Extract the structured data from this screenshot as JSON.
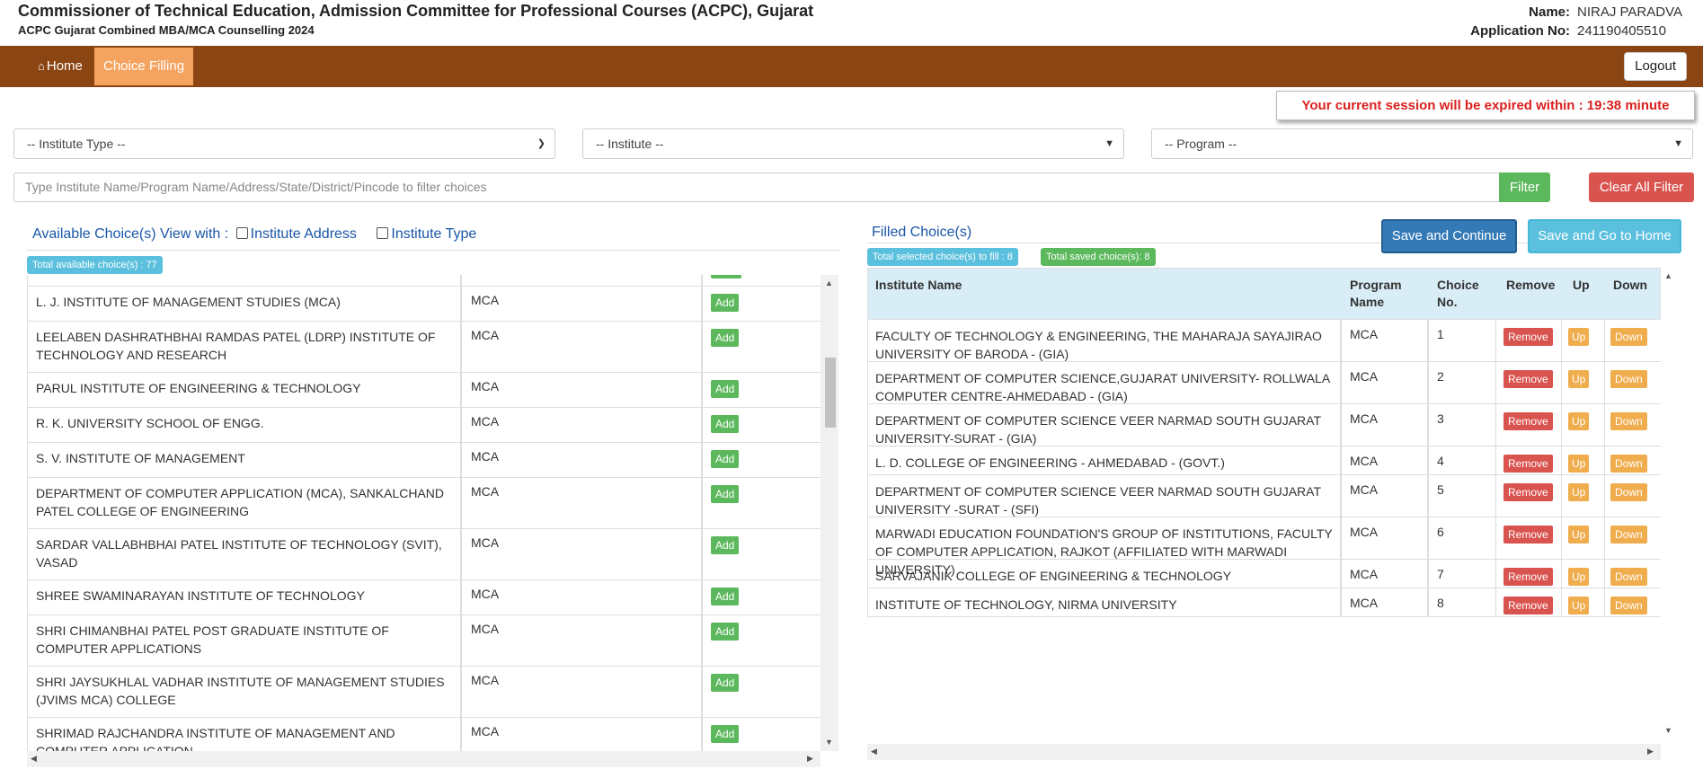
{
  "header": {
    "title": "Commissioner of Technical Education, Admission Committee for Professional Courses (ACPC), Gujarat",
    "subtitle": "ACPC Gujarat Combined MBA/MCA Counselling 2024",
    "name_label": "Name:",
    "name_value": "NIRAJ PARADVA",
    "app_label": "Application No:",
    "app_value": "241190405510"
  },
  "nav": {
    "home": "Home",
    "choice_filling": "Choice Filling",
    "logout": "Logout"
  },
  "session": {
    "text": "Your current session will be expired within : 19:38 minute"
  },
  "filters": {
    "institute_type": "-- Institute Type --",
    "institute": "-- Institute --",
    "program": "-- Program --",
    "search_placeholder": "Type Institute Name/Program Name/Address/State/District/Pincode to filter choices",
    "filter_btn": "Filter",
    "clear_btn": "Clear All Filter"
  },
  "available": {
    "heading": "Available Choice(s) View with :",
    "opt_address": "Institute Address",
    "opt_type": "Institute Type",
    "total_badge": "Total available choice(s) : 77",
    "add_label": "Add",
    "rows": [
      {
        "name": "L. J. INSTITUTE OF MANAGEMENT STUDIES (MCA)",
        "program": "MCA"
      },
      {
        "name": "LEELABEN DASHRATHBHAI RAMDAS PATEL (LDRP) INSTITUTE OF TECHNOLOGY AND RESEARCH",
        "program": "MCA"
      },
      {
        "name": "PARUL INSTITUTE OF ENGINEERING & TECHNOLOGY",
        "program": "MCA"
      },
      {
        "name": "R. K. UNIVERSITY SCHOOL OF ENGG.",
        "program": "MCA"
      },
      {
        "name": "S. V. INSTITUTE OF MANAGEMENT",
        "program": "MCA"
      },
      {
        "name": "DEPARTMENT OF COMPUTER APPLICATION (MCA), SANKALCHAND PATEL COLLEGE OF ENGINEERING",
        "program": "MCA"
      },
      {
        "name": "SARDAR VALLABHBHAI PATEL INSTITUTE OF TECHNOLOGY (SVIT), VASAD",
        "program": "MCA"
      },
      {
        "name": "SHREE SWAMINARAYAN INSTITUTE OF TECHNOLOGY",
        "program": "MCA"
      },
      {
        "name": "SHRI CHIMANBHAI PATEL POST GRADUATE INSTITUTE OF COMPUTER APPLICATIONS",
        "program": "MCA"
      },
      {
        "name": "SHRI JAYSUKHLAL VADHAR INSTITUTE OF MANAGEMENT STUDIES (JVIMS MCA) COLLEGE",
        "program": "MCA"
      },
      {
        "name": "SHRIMAD RAJCHANDRA INSTITUTE OF MANAGEMENT AND COMPUTER APPLICATION",
        "program": "MCA"
      }
    ]
  },
  "filled": {
    "heading": "Filled Choice(s)",
    "save_continue": "Save and Continue",
    "save_home": "Save and Go to Home",
    "selected_badge": "Total selected choice(s) to fill : 8",
    "saved_badge": "Total saved choice(s): 8",
    "columns": {
      "institute": "Institute Name",
      "program": "Program Name",
      "choice": "Choice No.",
      "remove": "Remove",
      "up": "Up",
      "down": "Down"
    },
    "btn_remove": "Remove",
    "btn_up": "Up",
    "btn_down": "Down",
    "rows": [
      {
        "name": "FACULTY OF TECHNOLOGY & ENGINEERING, THE MAHARAJA SAYAJIRAO UNIVERSITY OF BARODA - (GIA)",
        "program": "MCA",
        "choice": "1"
      },
      {
        "name": "DEPARTMENT OF COMPUTER SCIENCE,GUJARAT UNIVERSITY- ROLLWALA COMPUTER CENTRE-AHMEDABAD - (GIA)",
        "program": "MCA",
        "choice": "2"
      },
      {
        "name": "DEPARTMENT OF COMPUTER SCIENCE VEER NARMAD SOUTH GUJARAT UNIVERSITY-SURAT - (GIA)",
        "program": "MCA",
        "choice": "3"
      },
      {
        "name": "L. D. COLLEGE OF ENGINEERING - AHMEDABAD - (GOVT.)",
        "program": "MCA",
        "choice": "4"
      },
      {
        "name": "DEPARTMENT OF COMPUTER SCIENCE VEER NARMAD SOUTH GUJARAT UNIVERSITY -SURAT - (SFI)",
        "program": "MCA",
        "choice": "5"
      },
      {
        "name": "MARWADI EDUCATION FOUNDATION'S GROUP OF INSTITUTIONS, FACULTY OF COMPUTER APPLICATION, RAJKOT (AFFILIATED WITH MARWADI UNIVERSITY)",
        "program": "MCA",
        "choice": "6"
      },
      {
        "name": "SARVAJANIK COLLEGE OF ENGINEERING & TECHNOLOGY",
        "program": "MCA",
        "choice": "7"
      },
      {
        "name": "INSTITUTE OF TECHNOLOGY, NIRMA UNIVERSITY",
        "program": "MCA",
        "choice": "8"
      }
    ]
  }
}
